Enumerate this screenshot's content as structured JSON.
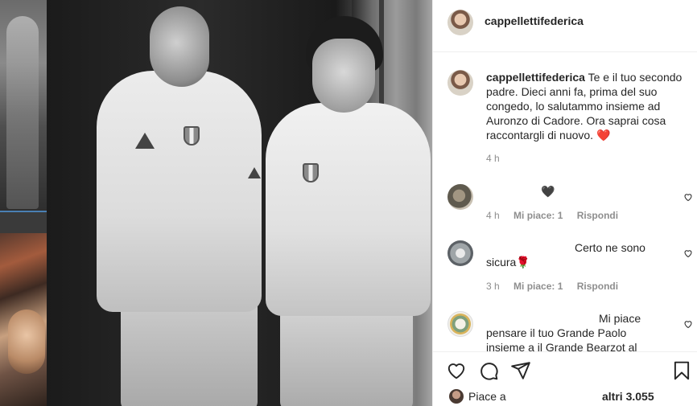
{
  "post": {
    "username": "cappellettifederica",
    "caption_user": "cappellettifederica",
    "caption_text": "Te e il tuo secondo padre. Dieci anni fa, prima del suo congedo, lo salutammo insieme ad Auronzo di Cadore. Ora saprai cosa raccontargli di nuovo. ❤️",
    "caption_time": "4 h"
  },
  "comments": [
    {
      "text": "🖤",
      "time": "4 h",
      "likes": "Mi piace: 1",
      "reply": "Rispondi"
    },
    {
      "text": "Certo ne sono sicura🌹",
      "time": "3 h",
      "likes": "Mi piace: 1",
      "reply": "Rispondi"
    },
    {
      "text": "Mi piace pensare il tuo Grande Paolo insieme a il Grande Bearzot al"
    }
  ],
  "likes_bar": {
    "prefix": "Piace a",
    "count": "altri 3.055"
  },
  "icons": [
    "like-icon",
    "comment-icon",
    "share-icon",
    "save-icon",
    "heart-small-icon"
  ],
  "colors": {
    "text": "#262626",
    "muted": "#8e8e8e",
    "divider": "#efefef"
  }
}
